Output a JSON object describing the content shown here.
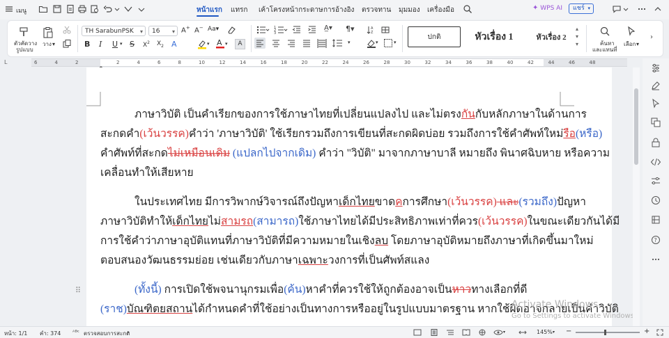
{
  "menubar": {
    "menu_label": "เมนู",
    "tabs": [
      "หน้าแรก",
      "แทรก",
      "เค้าโครงหน้ากระดาษ",
      "การอ้างอิง",
      "ตรวจทาน",
      "มุมมอง",
      "เครื่องมือ"
    ],
    "wps_ai": "WPS AI",
    "share": "แชร์"
  },
  "ribbon": {
    "format_painter": [
      "ตัวคัดวาง",
      "รูปแบบ"
    ],
    "paste": "วาง",
    "font_name": "TH SarabunPSK",
    "font_size": "16",
    "styles": [
      "ปกติ",
      "หัวเรื่อง 1",
      "หัวเรื่อง 2"
    ],
    "find_replace": [
      "ค้นหา",
      "และแทนที่"
    ],
    "select": "เลือก"
  },
  "ruler": {
    "numbers": [
      "6",
      "4",
      "2",
      "",
      "2",
      "4",
      "6",
      "8",
      "10",
      "12",
      "14",
      "16",
      "18",
      "20",
      "22",
      "24",
      "26",
      "28",
      "30",
      "32",
      "34",
      "36",
      "38",
      "40",
      "42",
      "44",
      "46",
      "48"
    ]
  },
  "document": {
    "p1": {
      "l1": {
        "a": "ภาษาวิบัติ เป็นคำเรียกของการใช้ภาษาไทยที่เปลี่ยนแปลงไป และไม่ตรง",
        "b": "กัน",
        "c": "กับหลักภาษาในด้านการ"
      },
      "l2": {
        "a": "สะกดคำ",
        "b": "(เว้นวรรค)",
        "c": "คำว่า 'ภาษาวิบัติ' ใช้เรียกรวมถึงการเขียนที่สะกดผิดบ่อย รวมถึงการใช้คำศัพท์ใหม่",
        "d": "รือ",
        "e": "(หรือ)"
      },
      "l3": {
        "a": "คำศัพท์ที่สะกด",
        "b": "ไม่เหมือนเดิม",
        "c": " (แปลกไปจากเดิม)",
        "d": " คำว่า \"วิบัติ\" มาจากภาษาบาลี หมายถึง พินาศฉิบหาย หรือความ"
      },
      "l4": "เคลื่อนทำให้เสียหาย"
    },
    "p2": {
      "l1": {
        "a": "ในประเทศไทย มีการวิพากษ์วิจารณ์ถึงปัญหา",
        "b": "เด็กไทย",
        "c": "ขาด",
        "d": "ค",
        "e": "การศึกษา",
        "f": "(เว้นวรรค)",
        "g": " และ",
        "h": "(รวมถึง)",
        "i": "ปัญหา"
      },
      "l2": {
        "a": "ภาษาวิบัติทำให้",
        "b": "เด็กไทย",
        "c": "ไม่",
        "d": "สามรถ",
        "e": "(สามารถ)",
        "f": "ใช้ภาษาไทยได้มีประสิทธิภาพเท่าที่ควร",
        "g": "(เว้นวรรค)",
        "h": "ในขณะเดียวกันได้มี"
      },
      "l3": {
        "a": "การใช้คำว่าภาษาอุบัติแทนที่ภาษาวิบัติที่มีความหมายในเชิง",
        "b": "ลบ",
        "c": " โดยภาษาอุบัติหมายถึงภาษาที่เกิดขึ้นมาใหม่"
      },
      "l4": {
        "a": "ตอบสนองวัฒนธรรมย่อย เช่นเดียวกับภาษา",
        "b": "เฉพาะ",
        "c": "วงการที่เป็นศัพท์สแลง"
      }
    },
    "p3": {
      "l1": {
        "a": "(ทั้งนี้)",
        "b": " การเปิดใช้พจนานุกรมเพื่อ",
        "c": "(ค้น)",
        "d": "หาคำที่ควรใช้ให้ถูกต้องอาจเป็น",
        "e": "หาว",
        "f": "ทางเลือกที่ดี"
      },
      "l2": {
        "a": "(ราช)",
        "b": "บัณฑิตยสถาน",
        "c": "ได้กำหนดคำที่ใช้อย่างเป็นทางการหรืออยู่ในรูปแบบมาตรฐาน หากใช้ผิดอาจกลายเป็นคำวิบัติ"
      }
    }
  },
  "watermark": {
    "title": "Activate Windows",
    "subtitle": "Go to Settings to activate Windows."
  },
  "status": {
    "page": "หน้า: 1/1",
    "words": "คำ: 374",
    "spell": "ตรวจสอบการสะกด",
    "zoom": "145%"
  }
}
